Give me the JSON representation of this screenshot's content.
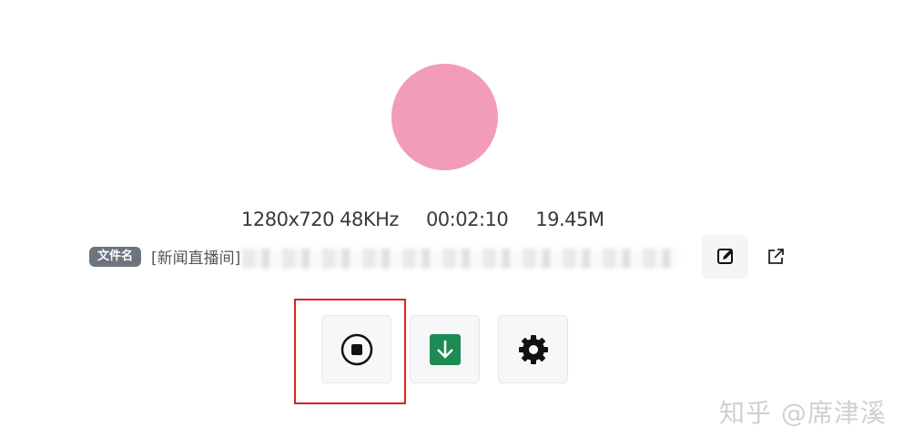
{
  "media": {
    "resolution_audio": "1280x720 48KHz",
    "duration": "00:02:10",
    "size": "19.45M"
  },
  "file": {
    "badge": "文件名",
    "name_visible": "[新闻直播间]"
  },
  "actions": {
    "record_icon": "stop-record-icon",
    "download_icon": "download-icon",
    "settings_icon": "gear-icon",
    "edit_icon": "edit-icon",
    "open_icon": "external-link-icon"
  },
  "colors": {
    "record_indicator": "#f29cba",
    "download": "#1e8a54",
    "highlight": "#e0211d"
  },
  "watermark": "知乎 @席津溪"
}
